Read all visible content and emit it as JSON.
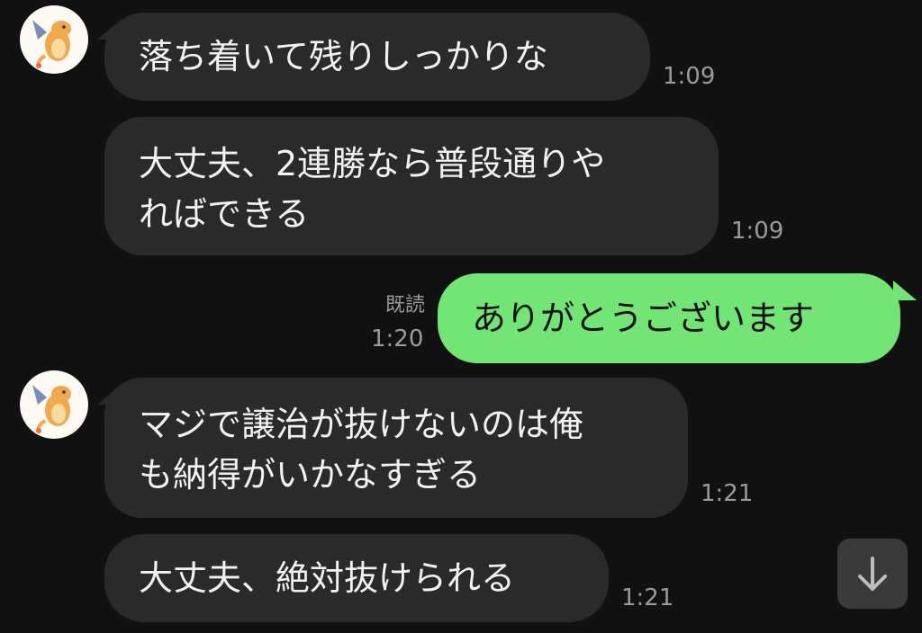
{
  "conversation": {
    "messages": [
      {
        "side": "incoming",
        "text": "落ち着いて残りしっかりな",
        "time": "1:09"
      },
      {
        "side": "incoming",
        "lines": [
          "大丈夫、2連勝なら普段通りや",
          "ればできる"
        ],
        "time": "1:09"
      },
      {
        "side": "outgoing",
        "text": "ありがとうございます",
        "time": "1:20",
        "read_label": "既読"
      },
      {
        "side": "incoming",
        "lines": [
          "マジで譲治が抜けないのは俺",
          "も納得がいかなすぎる"
        ],
        "time": "1:21"
      },
      {
        "side": "incoming",
        "text": "大丈夫、絶対抜けられる",
        "time": "1:21"
      }
    ]
  },
  "colors": {
    "background": "#111111",
    "incoming_bubble": "#2a2a2a",
    "outgoing_bubble": "#72e574",
    "timestamp_text": "#9a9a9a"
  },
  "icons": {
    "avatar": "orange-dragon-avatar",
    "scroll_down": "arrow-down-icon"
  }
}
